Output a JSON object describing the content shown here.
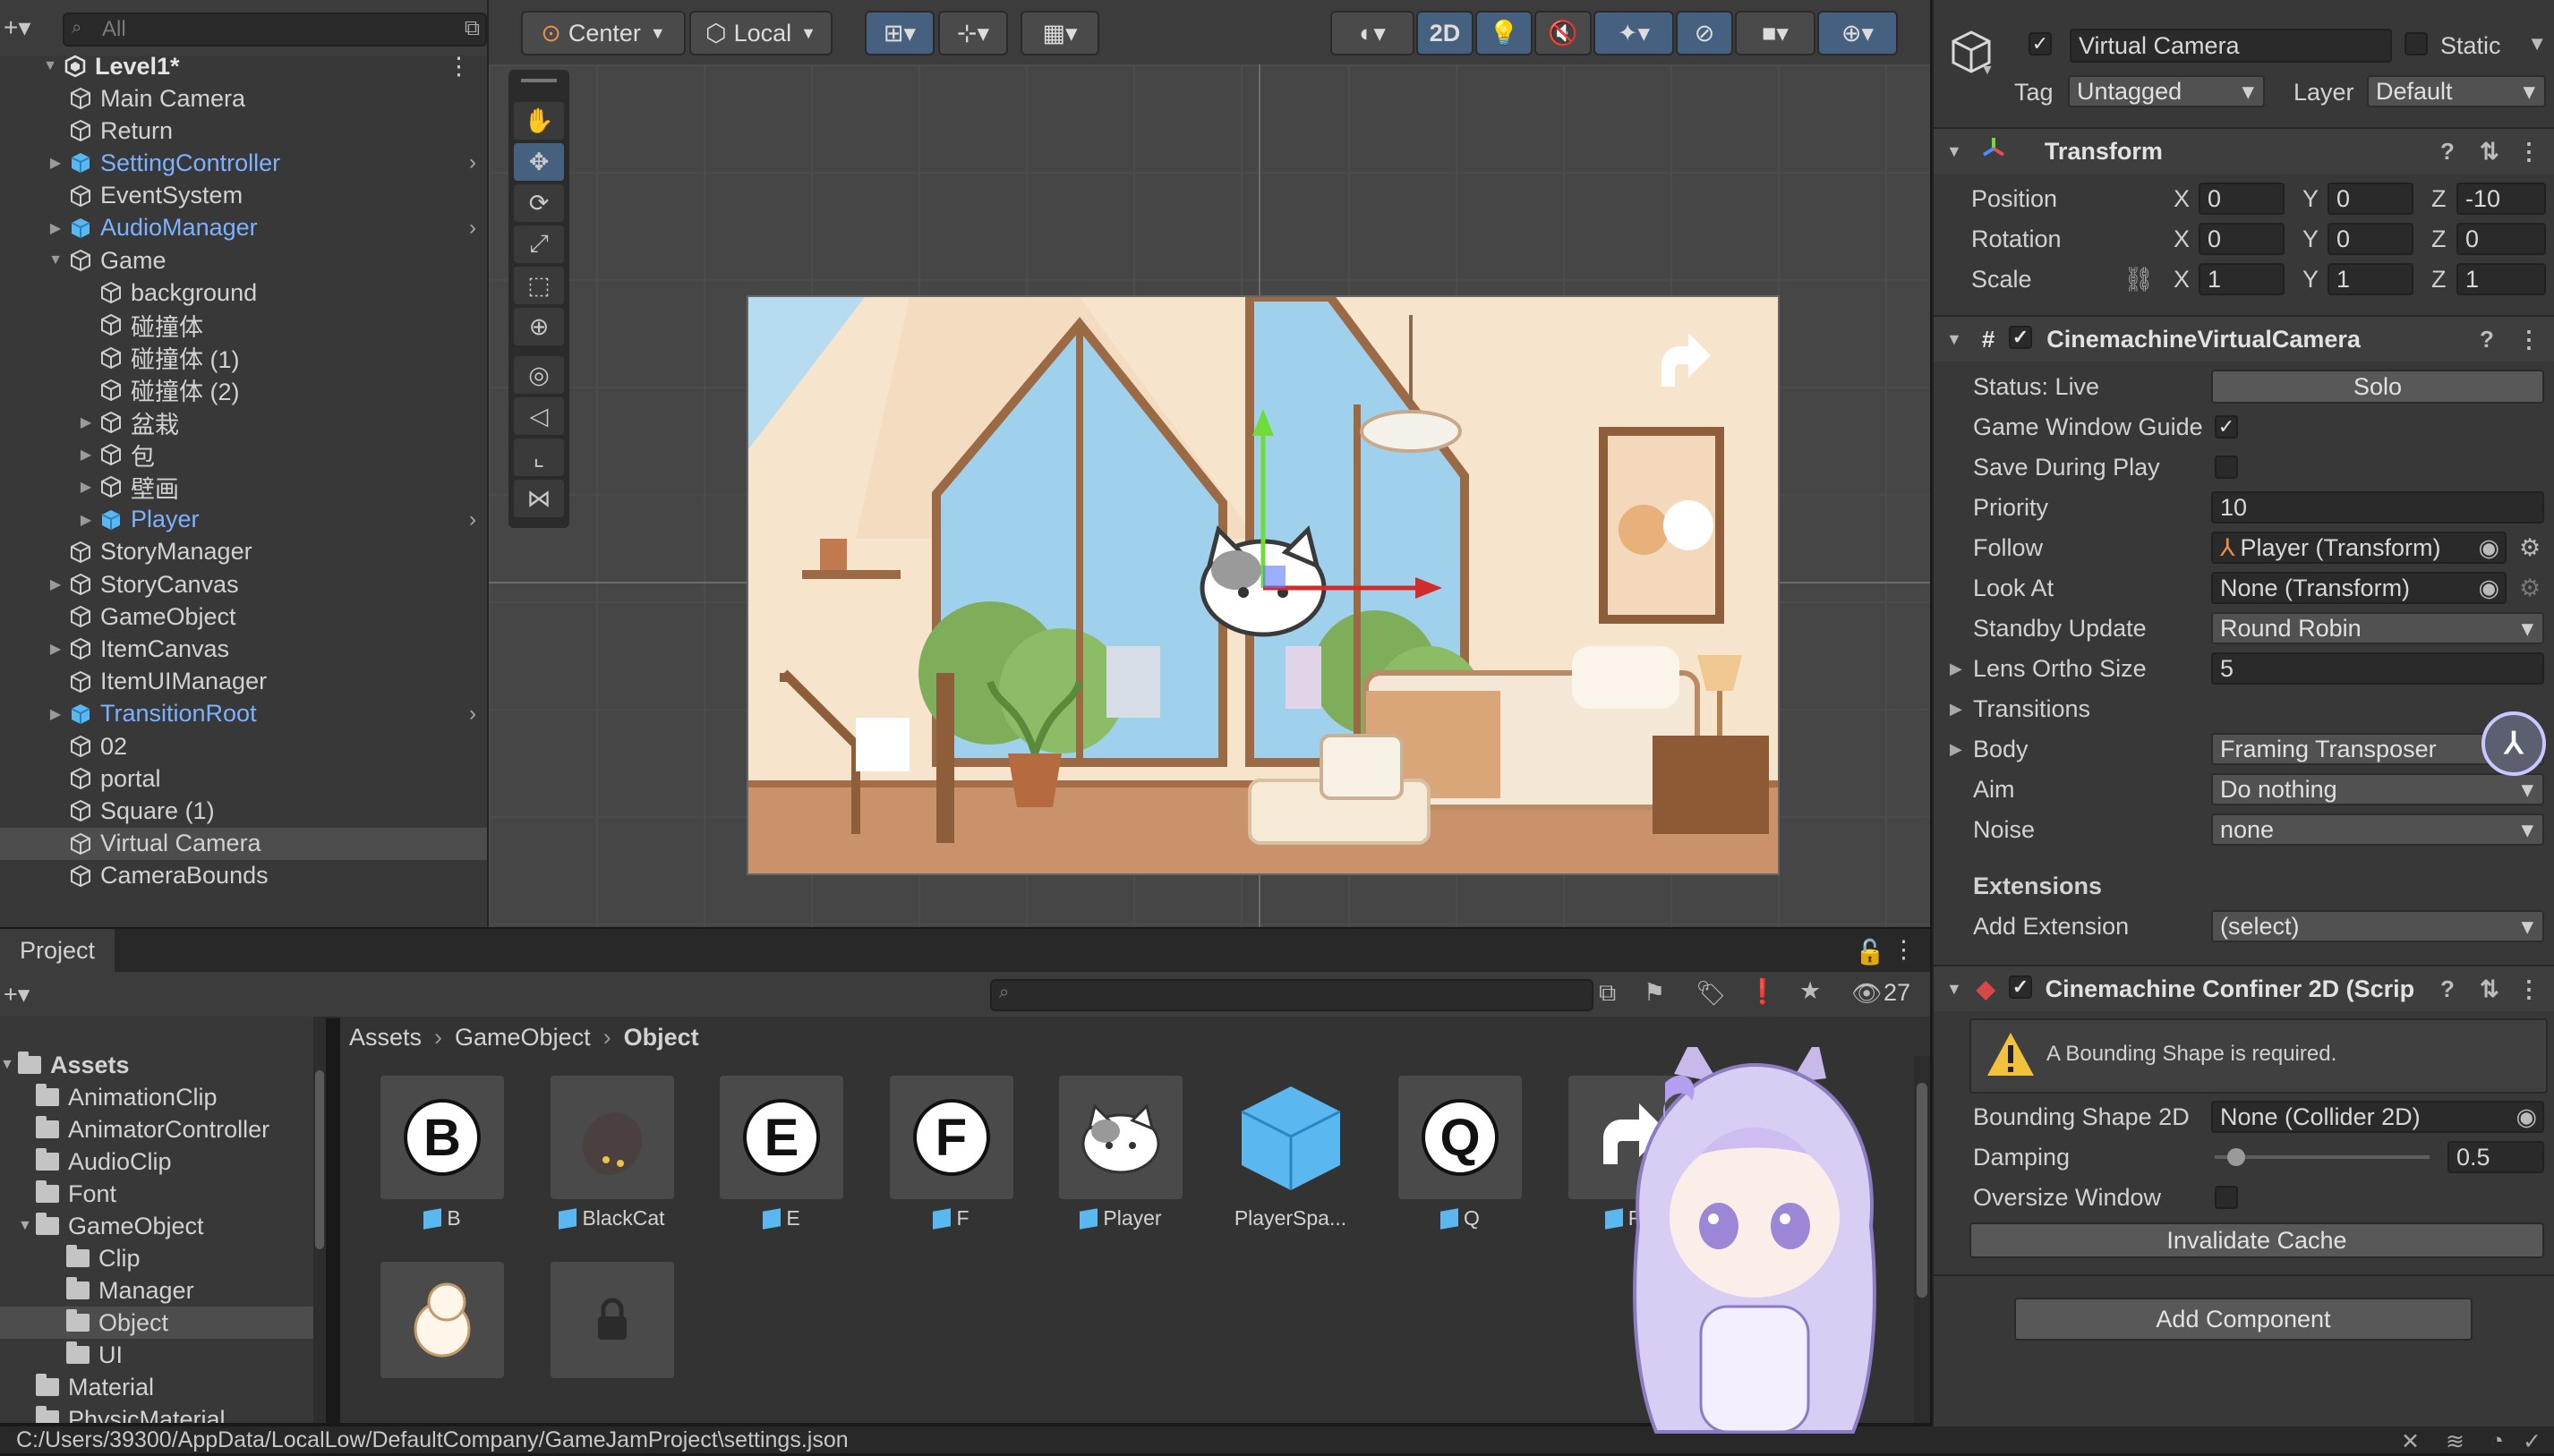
{
  "hierarchy": {
    "search_placeholder": "All",
    "scene_name": "Level1*",
    "items": [
      {
        "label": "Main Camera",
        "indent": 1,
        "prefab": false,
        "expand": ""
      },
      {
        "label": "Return",
        "indent": 1,
        "prefab": false,
        "expand": ""
      },
      {
        "label": "SettingController",
        "indent": 1,
        "prefab": true,
        "expand": "▶"
      },
      {
        "label": "EventSystem",
        "indent": 1,
        "prefab": false,
        "expand": ""
      },
      {
        "label": "AudioManager",
        "indent": 1,
        "prefab": true,
        "expand": "▶"
      },
      {
        "label": "Game",
        "indent": 1,
        "prefab": false,
        "expand": "▼"
      },
      {
        "label": "background",
        "indent": 2,
        "prefab": false,
        "expand": ""
      },
      {
        "label": "碰撞体",
        "indent": 2,
        "prefab": false,
        "expand": ""
      },
      {
        "label": "碰撞体 (1)",
        "indent": 2,
        "prefab": false,
        "expand": ""
      },
      {
        "label": "碰撞体 (2)",
        "indent": 2,
        "prefab": false,
        "expand": ""
      },
      {
        "label": "盆栽",
        "indent": 2,
        "prefab": false,
        "expand": "▶"
      },
      {
        "label": "包",
        "indent": 2,
        "prefab": false,
        "expand": "▶"
      },
      {
        "label": "壁画",
        "indent": 2,
        "prefab": false,
        "expand": "▶"
      },
      {
        "label": "Player",
        "indent": 2,
        "prefab": true,
        "expand": "▶"
      },
      {
        "label": "StoryManager",
        "indent": 1,
        "prefab": false,
        "expand": ""
      },
      {
        "label": "StoryCanvas",
        "indent": 1,
        "prefab": false,
        "expand": "▶"
      },
      {
        "label": "GameObject",
        "indent": 1,
        "prefab": false,
        "expand": ""
      },
      {
        "label": "ItemCanvas",
        "indent": 1,
        "prefab": false,
        "expand": "▶"
      },
      {
        "label": "ItemUIManager",
        "indent": 1,
        "prefab": false,
        "expand": ""
      },
      {
        "label": "TransitionRoot",
        "indent": 1,
        "prefab": true,
        "expand": "▶"
      },
      {
        "label": "02",
        "indent": 1,
        "prefab": false,
        "expand": ""
      },
      {
        "label": "portal",
        "indent": 1,
        "prefab": false,
        "expand": ""
      },
      {
        "label": "Square (1)",
        "indent": 1,
        "prefab": false,
        "expand": ""
      },
      {
        "label": "Virtual Camera",
        "indent": 1,
        "prefab": false,
        "expand": "",
        "selected": true
      },
      {
        "label": "CameraBounds",
        "indent": 1,
        "prefab": false,
        "expand": ""
      }
    ]
  },
  "scene_toolbar": {
    "pivot_label": "Center",
    "space_label": "Local",
    "mode_2d_label": "2D"
  },
  "project": {
    "tab_label": "Project",
    "item_count": "27",
    "breadcrumb": [
      "Assets",
      "GameObject",
      "Object"
    ],
    "tree": [
      {
        "label": "Assets",
        "indent": 0,
        "expand": "▼",
        "bold": true
      },
      {
        "label": "AnimationClip",
        "indent": 1,
        "expand": ""
      },
      {
        "label": "AnimatorController",
        "indent": 1,
        "expand": ""
      },
      {
        "label": "AudioClip",
        "indent": 1,
        "expand": ""
      },
      {
        "label": "Font",
        "indent": 1,
        "expand": ""
      },
      {
        "label": "GameObject",
        "indent": 1,
        "expand": "▼"
      },
      {
        "label": "Clip",
        "indent": 2,
        "expand": ""
      },
      {
        "label": "Manager",
        "indent": 2,
        "expand": ""
      },
      {
        "label": "Object",
        "indent": 2,
        "expand": "",
        "selected": true
      },
      {
        "label": "UI",
        "indent": 2,
        "expand": ""
      },
      {
        "label": "Material",
        "indent": 1,
        "expand": ""
      },
      {
        "label": "PhysicMaterial",
        "indent": 1,
        "expand": ""
      }
    ],
    "assets": [
      {
        "name": "B",
        "kind": "letter",
        "glyph": "B",
        "prefab_icon": true
      },
      {
        "name": "BlackCat",
        "kind": "blackcat",
        "glyph": "",
        "prefab_icon": true
      },
      {
        "name": "E",
        "kind": "letter",
        "glyph": "E",
        "prefab_icon": true
      },
      {
        "name": "F",
        "kind": "letter",
        "glyph": "F",
        "prefab_icon": true
      },
      {
        "name": "Player",
        "kind": "cat",
        "glyph": "",
        "prefab_icon": true
      },
      {
        "name": "PlayerSpa...",
        "kind": "cube",
        "glyph": "",
        "prefab_icon": false
      },
      {
        "name": "Q",
        "kind": "letter",
        "glyph": "Q",
        "prefab_icon": true
      },
      {
        "name": "Re",
        "kind": "return",
        "glyph": "",
        "prefab_icon": true
      }
    ],
    "row2": [
      {
        "kind": "whitecat"
      },
      {
        "kind": "lock"
      }
    ]
  },
  "status_path": "C:/Users/39300/AppData/LocalLow/DefaultCompany/GameJamProject\\settings.json",
  "inspector": {
    "object_name": "Virtual Camera",
    "static_label": "Static",
    "tag_label": "Tag",
    "tag_value": "Untagged",
    "layer_label": "Layer",
    "layer_value": "Default",
    "transform": {
      "title": "Transform",
      "position_label": "Position",
      "rotation_label": "Rotation",
      "scale_label": "Scale",
      "axis_x": "X",
      "axis_y": "Y",
      "axis_z": "Z",
      "position": {
        "x": "0",
        "y": "0",
        "z": "-10"
      },
      "rotation": {
        "x": "0",
        "y": "0",
        "z": "0"
      },
      "scale": {
        "x": "1",
        "y": "1",
        "z": "1"
      }
    },
    "vcam": {
      "title": "CinemachineVirtualCamera",
      "status": "Status: Live",
      "solo": "Solo",
      "game_window_guide": "Game Window Guide",
      "save_during_play": "Save During Play",
      "priority_label": "Priority",
      "priority": "10",
      "follow_label": "Follow",
      "follow": "Player (Transform)",
      "lookat_label": "Look At",
      "lookat": "None (Transform)",
      "standby_label": "Standby Update",
      "standby": "Round Robin",
      "lens_label": "Lens Ortho Size",
      "lens": "5",
      "transitions_label": "Transitions",
      "body_label": "Body",
      "body": "Framing Transposer",
      "aim_label": "Aim",
      "aim": "Do nothing",
      "noise_label": "Noise",
      "noise": "none",
      "extensions_label": "Extensions",
      "add_extension_label": "Add Extension",
      "add_extension": "(select)"
    },
    "confiner": {
      "title": "Cinemachine Confiner 2D (Scrip",
      "warning": "A Bounding Shape is required.",
      "bounding_label": "Bounding Shape 2D",
      "bounding": "None (Collider 2D)",
      "damping_label": "Damping",
      "damping": "0.5",
      "damping_fraction": 0.1,
      "oversize_label": "Oversize Window",
      "invalidate": "Invalidate Cache"
    },
    "add_component": "Add Component"
  }
}
